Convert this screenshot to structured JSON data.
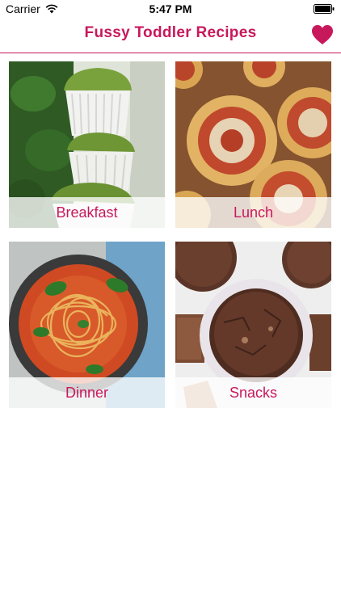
{
  "status_bar": {
    "carrier": "Carrier",
    "time": "5:47 PM"
  },
  "nav": {
    "title": "Fussy Toddler Recipes",
    "favorites_icon": "heart-icon",
    "accent_color": "#c8185c"
  },
  "categories": [
    {
      "label": "Breakfast",
      "image": "spinach muffins"
    },
    {
      "label": "Lunch",
      "image": "pizza pinwheels"
    },
    {
      "label": "Dinner",
      "image": "spaghetti with tomato sauce"
    },
    {
      "label": "Snacks",
      "image": "chocolate muffins"
    }
  ]
}
